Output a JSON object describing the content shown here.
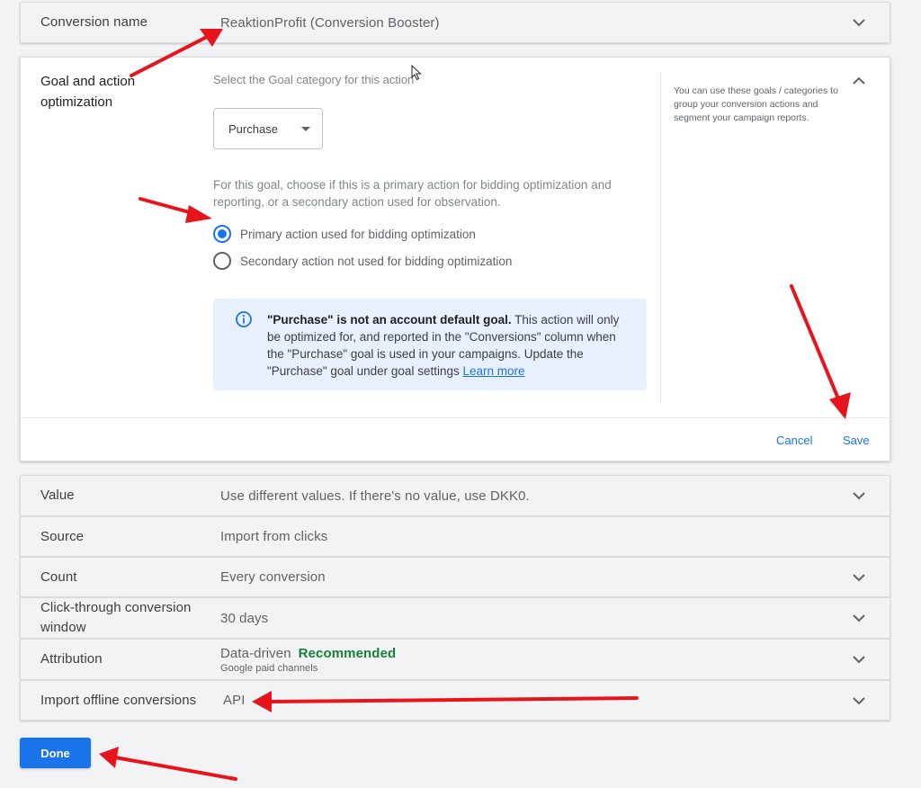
{
  "conversion_name": {
    "label": "Conversion name",
    "value": "ReaktionProfit (Conversion Booster)"
  },
  "goal": {
    "label": "Goal and action optimization",
    "prompt": "Select the Goal category for this action",
    "category_selected": "Purchase",
    "description": "For this goal, choose if this is a primary action for bidding optimization and reporting, or a secondary action used for observation.",
    "options": [
      {
        "label": "Primary action used for bidding optimization",
        "checked": true
      },
      {
        "label": "Secondary action not used for bidding optimization",
        "checked": false
      }
    ],
    "info": {
      "bold": "\"Purchase\" is not an account default goal.",
      "text": " This action will only be optimized for, and reported in the \"Conversions\" column when the \"Purchase\" goal is used in your campaigns. Update the \"Purchase\" goal under goal settings ",
      "link": "Learn more"
    },
    "help": "You can use these goals / categories to group your conversion actions and segment your campaign reports.",
    "cancel_label": "Cancel",
    "save_label": "Save"
  },
  "settings": {
    "value": {
      "label": "Value",
      "value": "Use different values. If there's no value, use DKK0."
    },
    "source": {
      "label": "Source",
      "value": "Import from clicks"
    },
    "count": {
      "label": "Count",
      "value": "Every conversion"
    },
    "click_window": {
      "label": "Click-through conversion window",
      "value": "30 days"
    },
    "attribution": {
      "label": "Attribution",
      "value": "Data-driven",
      "badge": "Recommended",
      "sub": "Google paid channels"
    },
    "offline": {
      "label": "Import offline conversions",
      "value": "API"
    }
  },
  "done_label": "Done",
  "colors": {
    "accent": "#1a73e8",
    "annotation": "#e8141c",
    "recommended": "#188038"
  }
}
